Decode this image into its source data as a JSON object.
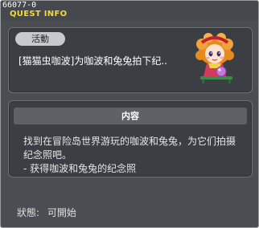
{
  "window": {
    "id_label": "66077-0",
    "title": "QUEST INFO"
  },
  "quest": {
    "category_tag": "活動",
    "name": "[猫猫虫咖波]为咖波和兔兔拍下纪.."
  },
  "npc": {
    "icon": "npc-portrait-icon"
  },
  "details": {
    "header": "内容",
    "lines": [
      "找到在冒险岛世界游玩的咖波和兔兔，为它们拍摄",
      "纪念照吧。",
      "- 获得咖波和兔兔的纪念照"
    ]
  },
  "status": {
    "label": "狀態:",
    "value": "可開始"
  },
  "colors": {
    "title_yellow": "#f5d93a",
    "window_bg": "#4a4d52",
    "panel_bg": "#3b3e42",
    "header_bar": "#5e6267",
    "tag_pill": "#c7c9cc"
  }
}
